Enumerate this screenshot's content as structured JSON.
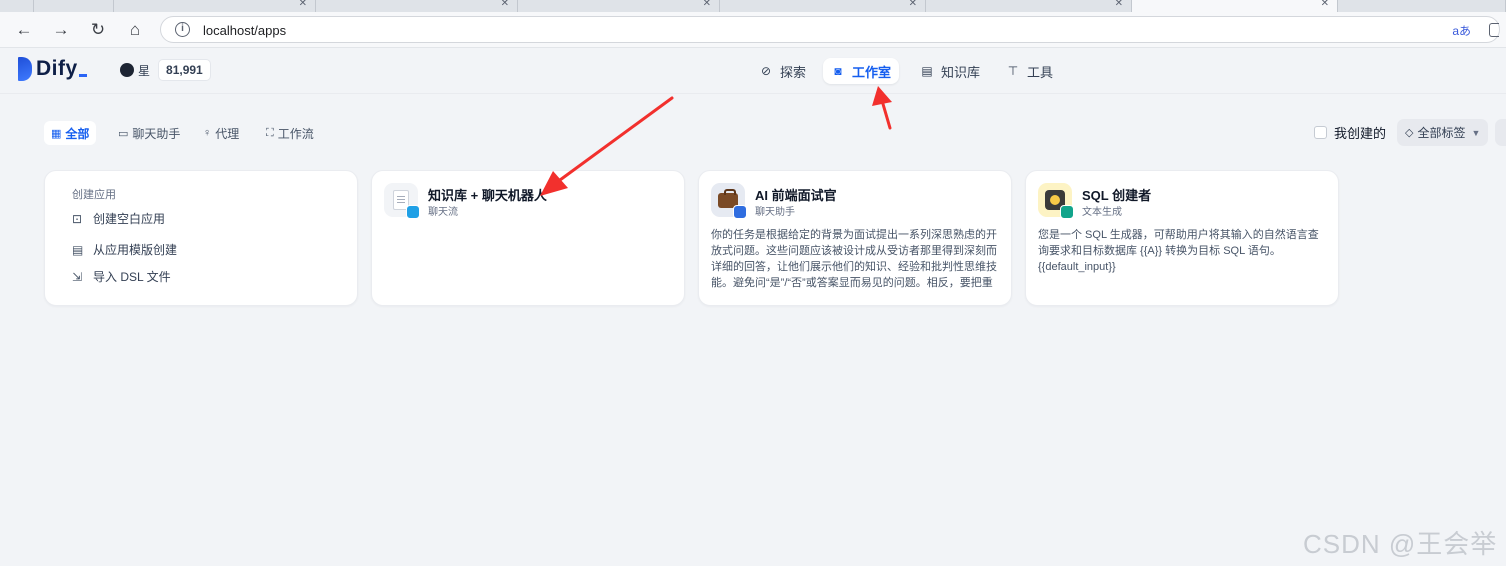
{
  "browser": {
    "url": "localhost/apps"
  },
  "header": {
    "brand": "Dify",
    "github": {
      "star_label": "星",
      "star_count": "81,991"
    },
    "nav": [
      {
        "label": "探索",
        "icon": "compass-icon"
      },
      {
        "label": "工作室",
        "icon": "robot-icon",
        "active": true
      },
      {
        "label": "知识库",
        "icon": "book-icon"
      },
      {
        "label": "工具",
        "icon": "hammer-icon"
      }
    ]
  },
  "filters": {
    "tabs": [
      {
        "label": "全部",
        "icon": "grid-icon",
        "active": true
      },
      {
        "label": "聊天助手",
        "icon": "chat-icon"
      },
      {
        "label": "代理",
        "icon": "agent-icon"
      },
      {
        "label": "工作流",
        "icon": "workflow-icon"
      }
    ],
    "mine_label": "我创建的",
    "tags_label": "全部标签"
  },
  "create": {
    "caption": "创建应用",
    "items": [
      {
        "label": "创建空白应用",
        "icon": "file-plus-icon"
      },
      {
        "label": "从应用模版创建",
        "icon": "template-icon"
      },
      {
        "label": "导入 DSL 文件",
        "icon": "import-icon"
      }
    ]
  },
  "apps": [
    {
      "name": "知识库 + 聊天机器人",
      "type": "聊天流",
      "desc": "",
      "icon": "document-icon",
      "badge_color": "#1fa0e6"
    },
    {
      "name": "AI 前端面试官",
      "type": "聊天助手",
      "desc": "你的任务是根据给定的背景为面试提出一系列深思熟虑的开放式问题。这些问题应该被设计成从受访者那里得到深刻而详细的回答，让他们展示他们的知识、经验和批判性思维技能。避免问“是”/“否”或答案显而易见的问题。相反，要把重点放在鼓励…",
      "icon": "briefcase-icon",
      "badge_color": "#2f6de0"
    },
    {
      "name": "SQL 创建者",
      "type": "文本生成",
      "desc": "您是一个 SQL 生成器，可帮助用户将其输入的自然语言查询要求和目标数据库 {{A}} 转换为目标 SQL 语句。{{default_input}}",
      "icon": "database-icon",
      "badge_color": "#12a48b"
    }
  ],
  "colors": {
    "accent": "#155eef",
    "annotation": "#f2302d"
  },
  "watermark": "CSDN @王会举"
}
